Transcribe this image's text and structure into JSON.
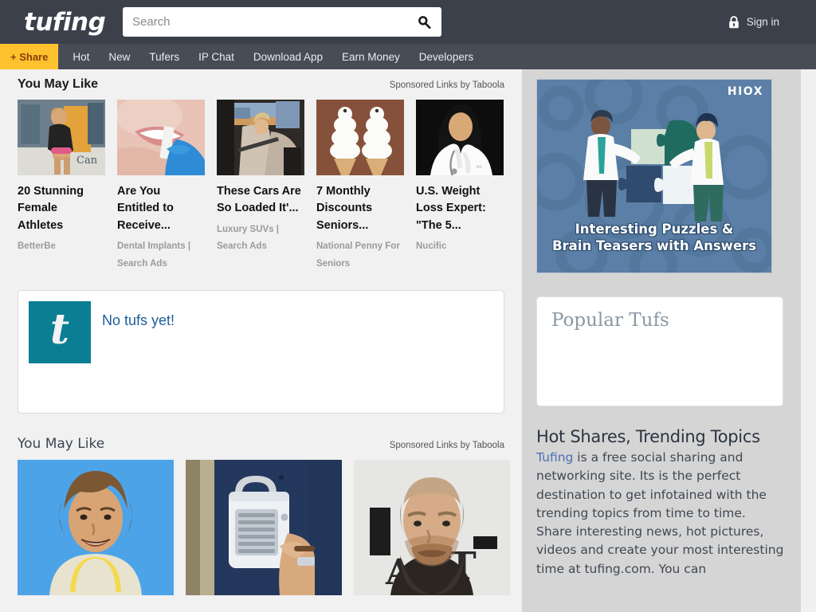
{
  "header": {
    "logo": "tufing",
    "search": {
      "value": "",
      "placeholder": "Search"
    },
    "search_icon": "magnifier-icon",
    "signin_label": "Sign in",
    "lock_icon": "lock-icon"
  },
  "navbar": {
    "share_label": "+ Share",
    "items": [
      {
        "label": "Hot"
      },
      {
        "label": "New"
      },
      {
        "label": "Tufers"
      },
      {
        "label": "IP Chat"
      },
      {
        "label": "Download App"
      },
      {
        "label": "Earn Money"
      },
      {
        "label": "Developers"
      }
    ]
  },
  "taboola_top": {
    "title": "You May Like",
    "by": "Sponsored Links by Taboola",
    "cards": [
      {
        "title": "20 Stunning Female Athletes",
        "source": "BetterBe"
      },
      {
        "title": "Are You Entitled to Receive...",
        "source": "Dental Implants | Search Ads"
      },
      {
        "title": "These Cars Are So Loaded It'...",
        "source": "Luxury SUVs | Search Ads"
      },
      {
        "title": "7 Monthly Discounts Seniors...",
        "source": "National Penny For Seniors"
      },
      {
        "title": "U.S. Weight Loss Expert: \"The 5...",
        "source": "Nucific"
      }
    ]
  },
  "tuf_card": {
    "avatar_letter": "t",
    "message": "No tufs yet!",
    "avatar_color": "#0b7e94",
    "message_color": "#1d5d9b"
  },
  "taboola_bottom": {
    "title": "You May Like",
    "by": "Sponsored Links by Taboola",
    "cards": [
      {
        "title": ""
      },
      {
        "title": ""
      },
      {
        "title": ""
      }
    ]
  },
  "sidebar": {
    "ad": {
      "brand": "HIOX",
      "caption_line1": "Interesting Puzzles &",
      "caption_line2": "Brain Teasers with Answers",
      "bg_color": "#5b7fa6"
    },
    "popular_panel": {
      "title": "Popular Tufs"
    },
    "about": {
      "title": "Hot Shares, Trending Topics",
      "link_text": "Tufing",
      "body": " is a free social sharing and networking site. Its is the perfect destination to get infotained with the trending topics from time to time. Share interesting news, hot pictures, videos and create your most interesting time at tufing.com. You can"
    }
  }
}
